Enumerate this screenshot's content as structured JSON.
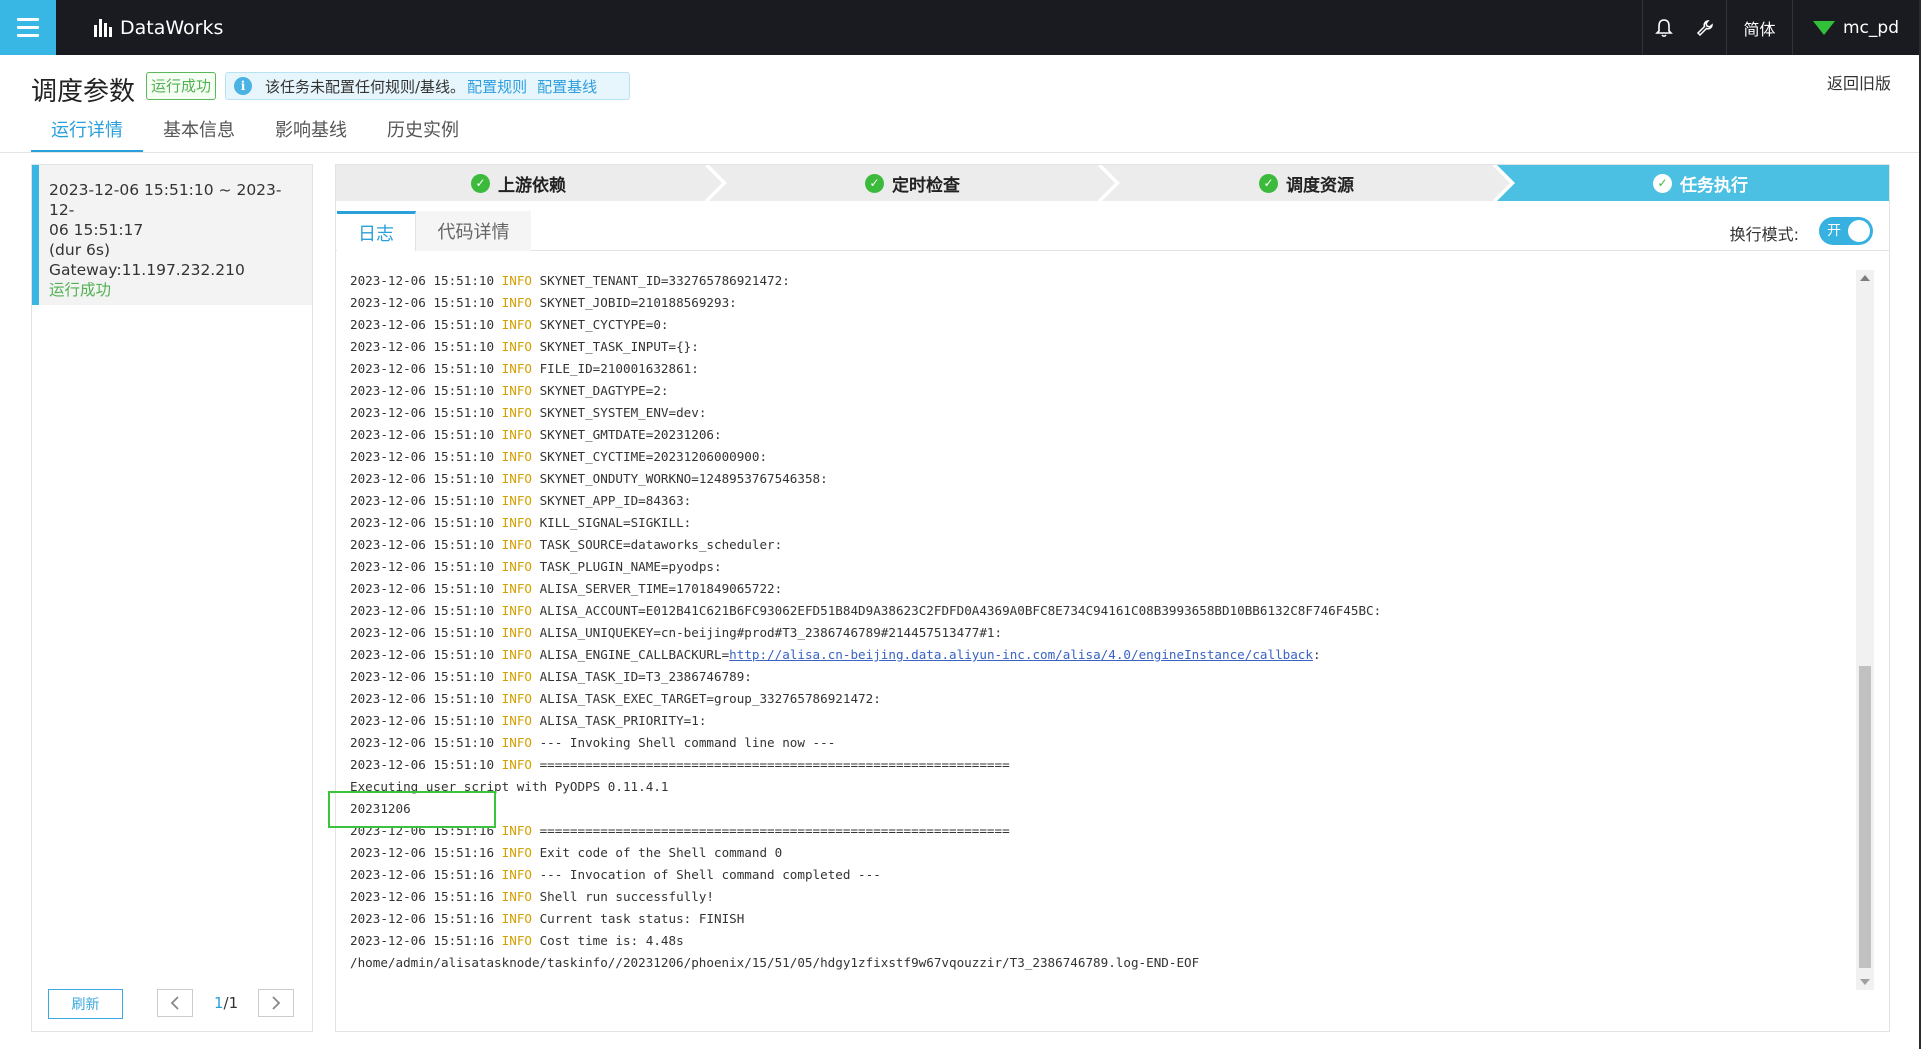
{
  "topbar": {
    "product_name": "DataWorks",
    "language": "简体",
    "username": "mc_pd"
  },
  "header": {
    "title": "调度参数",
    "status": "运行成功",
    "notice_text": "该任务未配置任何规则/基线。",
    "configure_rules": "配置规则",
    "configure_baseline": "配置基线",
    "back_old_version": "返回旧版"
  },
  "tabs": [
    "运行详情",
    "基本信息",
    "影响基线",
    "历史实例"
  ],
  "run_card": {
    "time_range_line1": "2023-12-06 15:51:10 ~ 2023-12-",
    "time_range_line2": "06 15:51:17",
    "duration": "(dur 6s)",
    "gateway": "Gateway:11.197.232.210",
    "status": "运行成功"
  },
  "left_footer": {
    "refresh_label": "刷新",
    "page_current": "1",
    "page_total": "/1"
  },
  "steps": [
    "上游依赖",
    "定时检查",
    "调度资源",
    "任务执行"
  ],
  "sub_tabs": [
    "日志",
    "代码详情"
  ],
  "wrap_mode": {
    "label": "换行模式:",
    "toggle_text": "开"
  },
  "log_lines": [
    {
      "ts": "2023-12-06 15:51:10",
      "level": "INFO",
      "msg": "SKYNET_TENANT_ID=332765786921472:"
    },
    {
      "ts": "2023-12-06 15:51:10",
      "level": "INFO",
      "msg": "SKYNET_JOBID=210188569293:"
    },
    {
      "ts": "2023-12-06 15:51:10",
      "level": "INFO",
      "msg": "SKYNET_CYCTYPE=0:"
    },
    {
      "ts": "2023-12-06 15:51:10",
      "level": "INFO",
      "msg": "SKYNET_TASK_INPUT={}:"
    },
    {
      "ts": "2023-12-06 15:51:10",
      "level": "INFO",
      "msg": "FILE_ID=210001632861:"
    },
    {
      "ts": "2023-12-06 15:51:10",
      "level": "INFO",
      "msg": "SKYNET_DAGTYPE=2:"
    },
    {
      "ts": "2023-12-06 15:51:10",
      "level": "INFO",
      "msg": "SKYNET_SYSTEM_ENV=dev:"
    },
    {
      "ts": "2023-12-06 15:51:10",
      "level": "INFO",
      "msg": "SKYNET_GMTDATE=20231206:"
    },
    {
      "ts": "2023-12-06 15:51:10",
      "level": "INFO",
      "msg": "SKYNET_CYCTIME=20231206000900:"
    },
    {
      "ts": "2023-12-06 15:51:10",
      "level": "INFO",
      "msg": "SKYNET_ONDUTY_WORKNO=1248953767546358:"
    },
    {
      "ts": "2023-12-06 15:51:10",
      "level": "INFO",
      "msg": "SKYNET_APP_ID=84363:"
    },
    {
      "ts": "2023-12-06 15:51:10",
      "level": "INFO",
      "msg": "KILL_SIGNAL=SIGKILL:"
    },
    {
      "ts": "2023-12-06 15:51:10",
      "level": "INFO",
      "msg": "TASK_SOURCE=dataworks_scheduler:"
    },
    {
      "ts": "2023-12-06 15:51:10",
      "level": "INFO",
      "msg": "TASK_PLUGIN_NAME=pyodps:"
    },
    {
      "ts": "2023-12-06 15:51:10",
      "level": "INFO",
      "msg": "ALISA_SERVER_TIME=1701849065722:"
    },
    {
      "ts": "2023-12-06 15:51:10",
      "level": "INFO",
      "msg": "ALISA_ACCOUNT=E012B41C621B6FC93062EFD51B84D9A38623C2FDFD0A4369A0BFC8E734C94161C08B3993658BD10BB6132C8F746F45BC:"
    },
    {
      "ts": "2023-12-06 15:51:10",
      "level": "INFO",
      "msg": "ALISA_UNIQUEKEY=cn-beijing#prod#T3_2386746789#214457513477#1:"
    },
    {
      "ts": "2023-12-06 15:51:10",
      "level": "INFO",
      "msg": "ALISA_ENGINE_CALLBACKURL=",
      "link": "http://alisa.cn-beijing.data.aliyun-inc.com/alisa/4.0/engineInstance/callback",
      "after": ":"
    },
    {
      "ts": "2023-12-06 15:51:10",
      "level": "INFO",
      "msg": "ALISA_TASK_ID=T3_2386746789:"
    },
    {
      "ts": "2023-12-06 15:51:10",
      "level": "INFO",
      "msg": "ALISA_TASK_EXEC_TARGET=group_332765786921472:"
    },
    {
      "ts": "2023-12-06 15:51:10",
      "level": "INFO",
      "msg": "ALISA_TASK_PRIORITY=1:"
    },
    {
      "ts": "2023-12-06 15:51:10",
      "level": "INFO",
      "msg": "--- Invoking Shell command line now ---"
    },
    {
      "ts": "2023-12-06 15:51:10",
      "level": "INFO",
      "msg": "=============================================================="
    },
    {
      "raw": "Executing user script with PyODPS 0.11.4.1"
    },
    {
      "raw": "20231206"
    },
    {
      "ts": "2023-12-06 15:51:16",
      "level": "INFO",
      "msg": "=============================================================="
    },
    {
      "ts": "2023-12-06 15:51:16",
      "level": "INFO",
      "msg": "Exit code of the Shell command 0"
    },
    {
      "ts": "2023-12-06 15:51:16",
      "level": "INFO",
      "msg": "--- Invocation of Shell command completed ---"
    },
    {
      "ts": "2023-12-06 15:51:16",
      "level": "INFO",
      "msg": "Shell run successfully!"
    },
    {
      "ts": "2023-12-06 15:51:16",
      "level": "INFO",
      "msg": "Current task status: FINISH"
    },
    {
      "ts": "2023-12-06 15:51:16",
      "level": "INFO",
      "msg": "Cost time is: 4.48s"
    },
    {
      "raw": "/home/admin/alisatasknode/taskinfo//20231206/phoenix/15/51/05/hdgy1zfixstf9w67vqouzzir/T3_2386746789.log-END-EOF"
    }
  ],
  "colors": {
    "accent": "#2aa0db",
    "topbar_bg": "#1a1b21",
    "step_active_bg": "#4cc0e2",
    "step_inactive_bg": "#ececec",
    "success_green": "#52b152",
    "info_level": "#d4a000",
    "highlight_box": "#3cc23c"
  }
}
